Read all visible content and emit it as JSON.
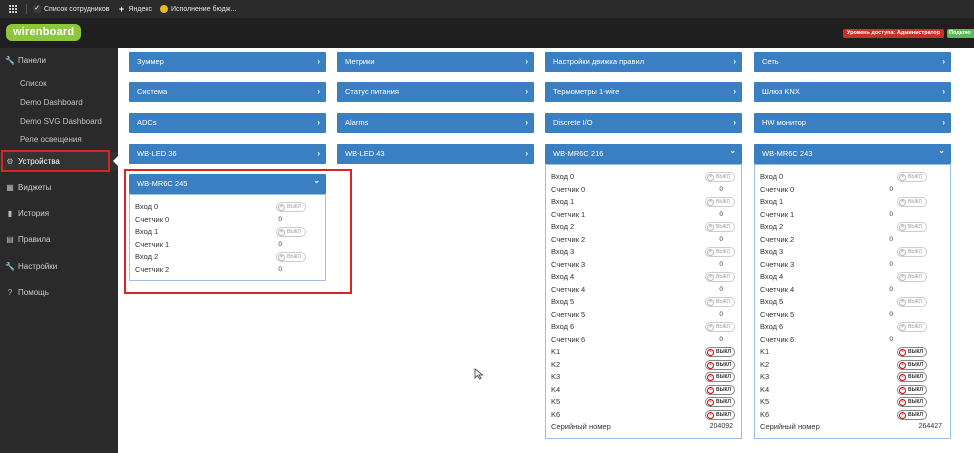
{
  "bookmarks": [
    {
      "label": "Список сотрудников",
      "icon": "check-icon"
    },
    {
      "label": "Яндекс",
      "icon": "plus-icon"
    },
    {
      "label": "Исполнение бюдж...",
      "icon": "coin-icon"
    }
  ],
  "header": {
    "logo": "wirenboard",
    "access_label": "Уровень доступа: Администратор",
    "second_badge": "Подклю"
  },
  "sidebar": {
    "panels": "Панели",
    "sub": [
      "Список",
      "Demo Dashboard",
      "Demo SVG Dashboard",
      "Реле освещения"
    ],
    "devices": "Устройства",
    "widgets": "Виджеты",
    "history": "История",
    "rules": "Правила",
    "settings": "Настройки",
    "help": "Помощь"
  },
  "tiles": [
    "Зуммер",
    "Метрики",
    "Настройки движка правил",
    "Сеть",
    "Система",
    "Статус питания",
    "Термометры 1-wire",
    "Шлюз KNX",
    "ADCs",
    "Alarms",
    "Discrete I/O",
    "HW монитор",
    "WB-LED 36",
    "WB-LED 43"
  ],
  "colors": {
    "accent": "#3a7fc1",
    "logo": "#8dc63f",
    "highlight": "#dd2222"
  },
  "toggle_off": "ВЫКЛ",
  "chevron_right": "›",
  "chevron_down": "⌄",
  "mr245": {
    "title": "WB-MR6C 245",
    "rows": [
      {
        "label": "Вход 0",
        "type": "toggle"
      },
      {
        "label": "Счетчик 0",
        "type": "value",
        "value": "0"
      },
      {
        "label": "Вход 1",
        "type": "toggle"
      },
      {
        "label": "Счетчик 1",
        "type": "value",
        "value": "0"
      },
      {
        "label": "Вход 2",
        "type": "toggle"
      },
      {
        "label": "Счетчик 2",
        "type": "value",
        "value": "0"
      }
    ]
  },
  "mr216": {
    "title": "WB-MR6C 216",
    "rows": [
      {
        "label": "Вход 0",
        "type": "toggle"
      },
      {
        "label": "Счетчик 0",
        "type": "value",
        "value": "0"
      },
      {
        "label": "Вход 1",
        "type": "toggle"
      },
      {
        "label": "Счетчик 1",
        "type": "value",
        "value": "0"
      },
      {
        "label": "Вход 2",
        "type": "toggle"
      },
      {
        "label": "Счетчик 2",
        "type": "value",
        "value": "0"
      },
      {
        "label": "Вход 3",
        "type": "toggle"
      },
      {
        "label": "Счетчик 3",
        "type": "value",
        "value": "0"
      },
      {
        "label": "Вход 4",
        "type": "toggle"
      },
      {
        "label": "Счетчик 4",
        "type": "value",
        "value": "0"
      },
      {
        "label": "Вход 5",
        "type": "toggle"
      },
      {
        "label": "Счетчик 5",
        "type": "value",
        "value": "0"
      },
      {
        "label": "Вход 6",
        "type": "toggle"
      },
      {
        "label": "Счетчик 6",
        "type": "value",
        "value": "0"
      },
      {
        "label": "K1",
        "type": "relay"
      },
      {
        "label": "K2",
        "type": "relay"
      },
      {
        "label": "K3",
        "type": "relay"
      },
      {
        "label": "K4",
        "type": "relay"
      },
      {
        "label": "K5",
        "type": "relay"
      },
      {
        "label": "K6",
        "type": "relay"
      },
      {
        "label": "Серийный номер",
        "type": "value",
        "value": "204092"
      }
    ]
  },
  "mr243": {
    "title": "WB-MR6C 243",
    "rows": [
      {
        "label": "Вход 0",
        "type": "toggle"
      },
      {
        "label": "Счетчик 0",
        "type": "value",
        "value": "0"
      },
      {
        "label": "Вход 1",
        "type": "toggle"
      },
      {
        "label": "Счетчик 1",
        "type": "value",
        "value": "0"
      },
      {
        "label": "Вход 2",
        "type": "toggle"
      },
      {
        "label": "Счетчик 2",
        "type": "value",
        "value": "0"
      },
      {
        "label": "Вход 3",
        "type": "toggle"
      },
      {
        "label": "Счетчик 3",
        "type": "value",
        "value": "0"
      },
      {
        "label": "Вход 4",
        "type": "toggle"
      },
      {
        "label": "Счетчик 4",
        "type": "value",
        "value": "0"
      },
      {
        "label": "Вход 5",
        "type": "toggle"
      },
      {
        "label": "Счетчик 5",
        "type": "value",
        "value": "0"
      },
      {
        "label": "Вход 6",
        "type": "toggle"
      },
      {
        "label": "Счетчик 6",
        "type": "value",
        "value": "0"
      },
      {
        "label": "K1",
        "type": "relay"
      },
      {
        "label": "K2",
        "type": "relay"
      },
      {
        "label": "K3",
        "type": "relay"
      },
      {
        "label": "K4",
        "type": "relay"
      },
      {
        "label": "K5",
        "type": "relay"
      },
      {
        "label": "K6",
        "type": "relay"
      },
      {
        "label": "Серийный номер",
        "type": "value",
        "value": "264427"
      }
    ]
  }
}
